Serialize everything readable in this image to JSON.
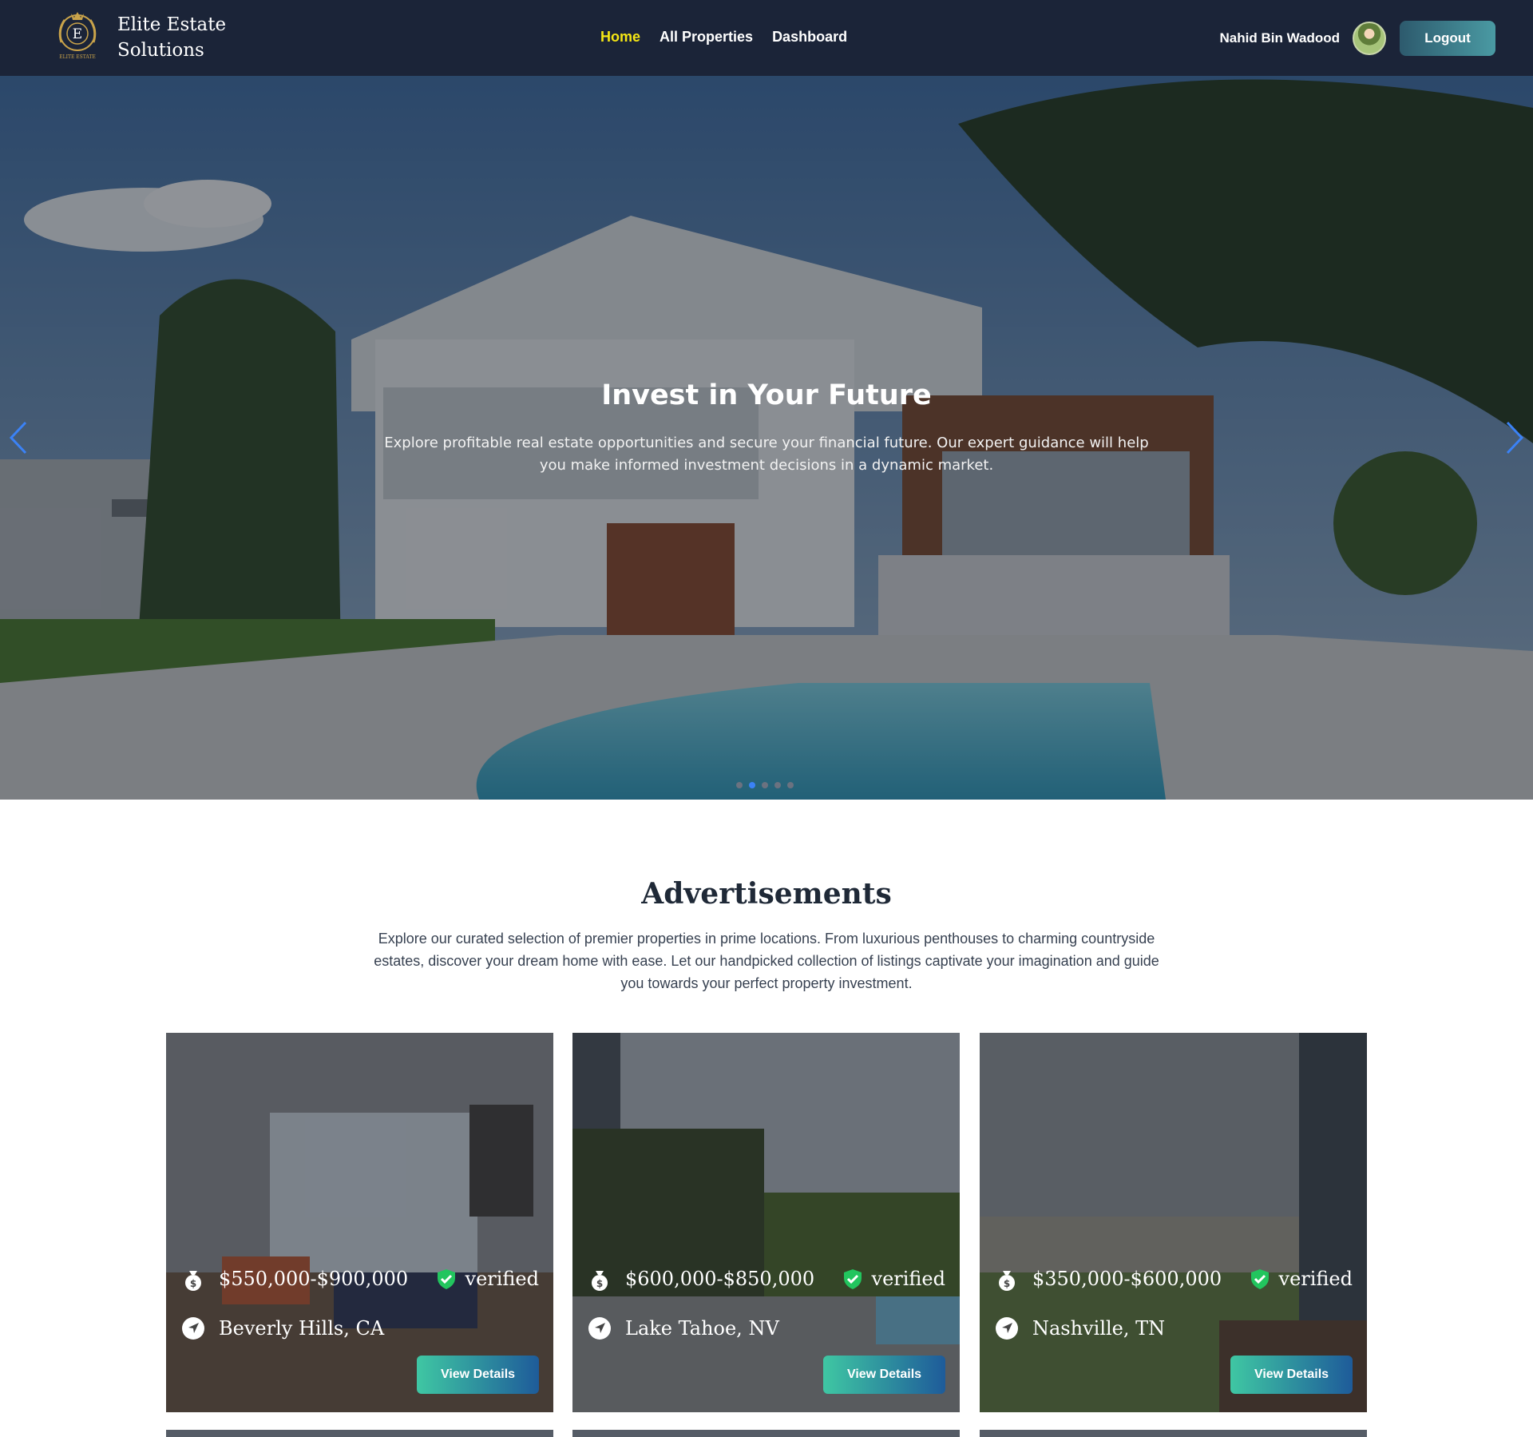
{
  "brand": {
    "name": "Elite Estate Solutions",
    "logo_letter": "E",
    "logo_text": "ELITE ESTATE"
  },
  "nav": {
    "items": [
      {
        "label": "Home",
        "active": true
      },
      {
        "label": "All Properties"
      },
      {
        "label": "Dashboard"
      }
    ]
  },
  "user": {
    "name": "Nahid Bin Wadood",
    "logout_label": "Logout"
  },
  "hero": {
    "title": "Invest in Your Future",
    "text": "Explore profitable real estate opportunities and secure your financial future. Our expert guidance will help you make informed investment decisions in a dynamic market.",
    "slide_count": 5,
    "active_slide": 2
  },
  "advertisements": {
    "title": "Advertisements",
    "description": "Explore our curated selection of premier properties in prime locations. From luxurious penthouses to charming countryside estates, discover your dream home with ease. Let our handpicked collection of listings captivate your imagination and guide you towards your perfect property investment.",
    "cards": [
      {
        "price": "$550,000-$900,000",
        "status": "verified",
        "location": "Beverly Hills, CA",
        "button": "View Details"
      },
      {
        "price": "$600,000-$850,000",
        "status": "verified",
        "location": "Lake Tahoe, NV",
        "button": "View Details"
      },
      {
        "price": "$350,000-$600,000",
        "status": "verified",
        "location": "Nashville, TN",
        "button": "View Details"
      }
    ]
  },
  "colors": {
    "navbar": "#1b2438",
    "active_nav": "#f5e614",
    "verified_green": "#22c55e",
    "button_start": "#3fc7a3",
    "button_end": "#1e5b9a",
    "logout_start": "#2d5a6d",
    "logout_end": "#4a9aa3"
  },
  "icons": {
    "price": "money-bag-icon",
    "verified": "shield-check-icon",
    "location": "location-arrow-icon",
    "prev": "chevron-left-icon",
    "next": "chevron-right-icon"
  }
}
